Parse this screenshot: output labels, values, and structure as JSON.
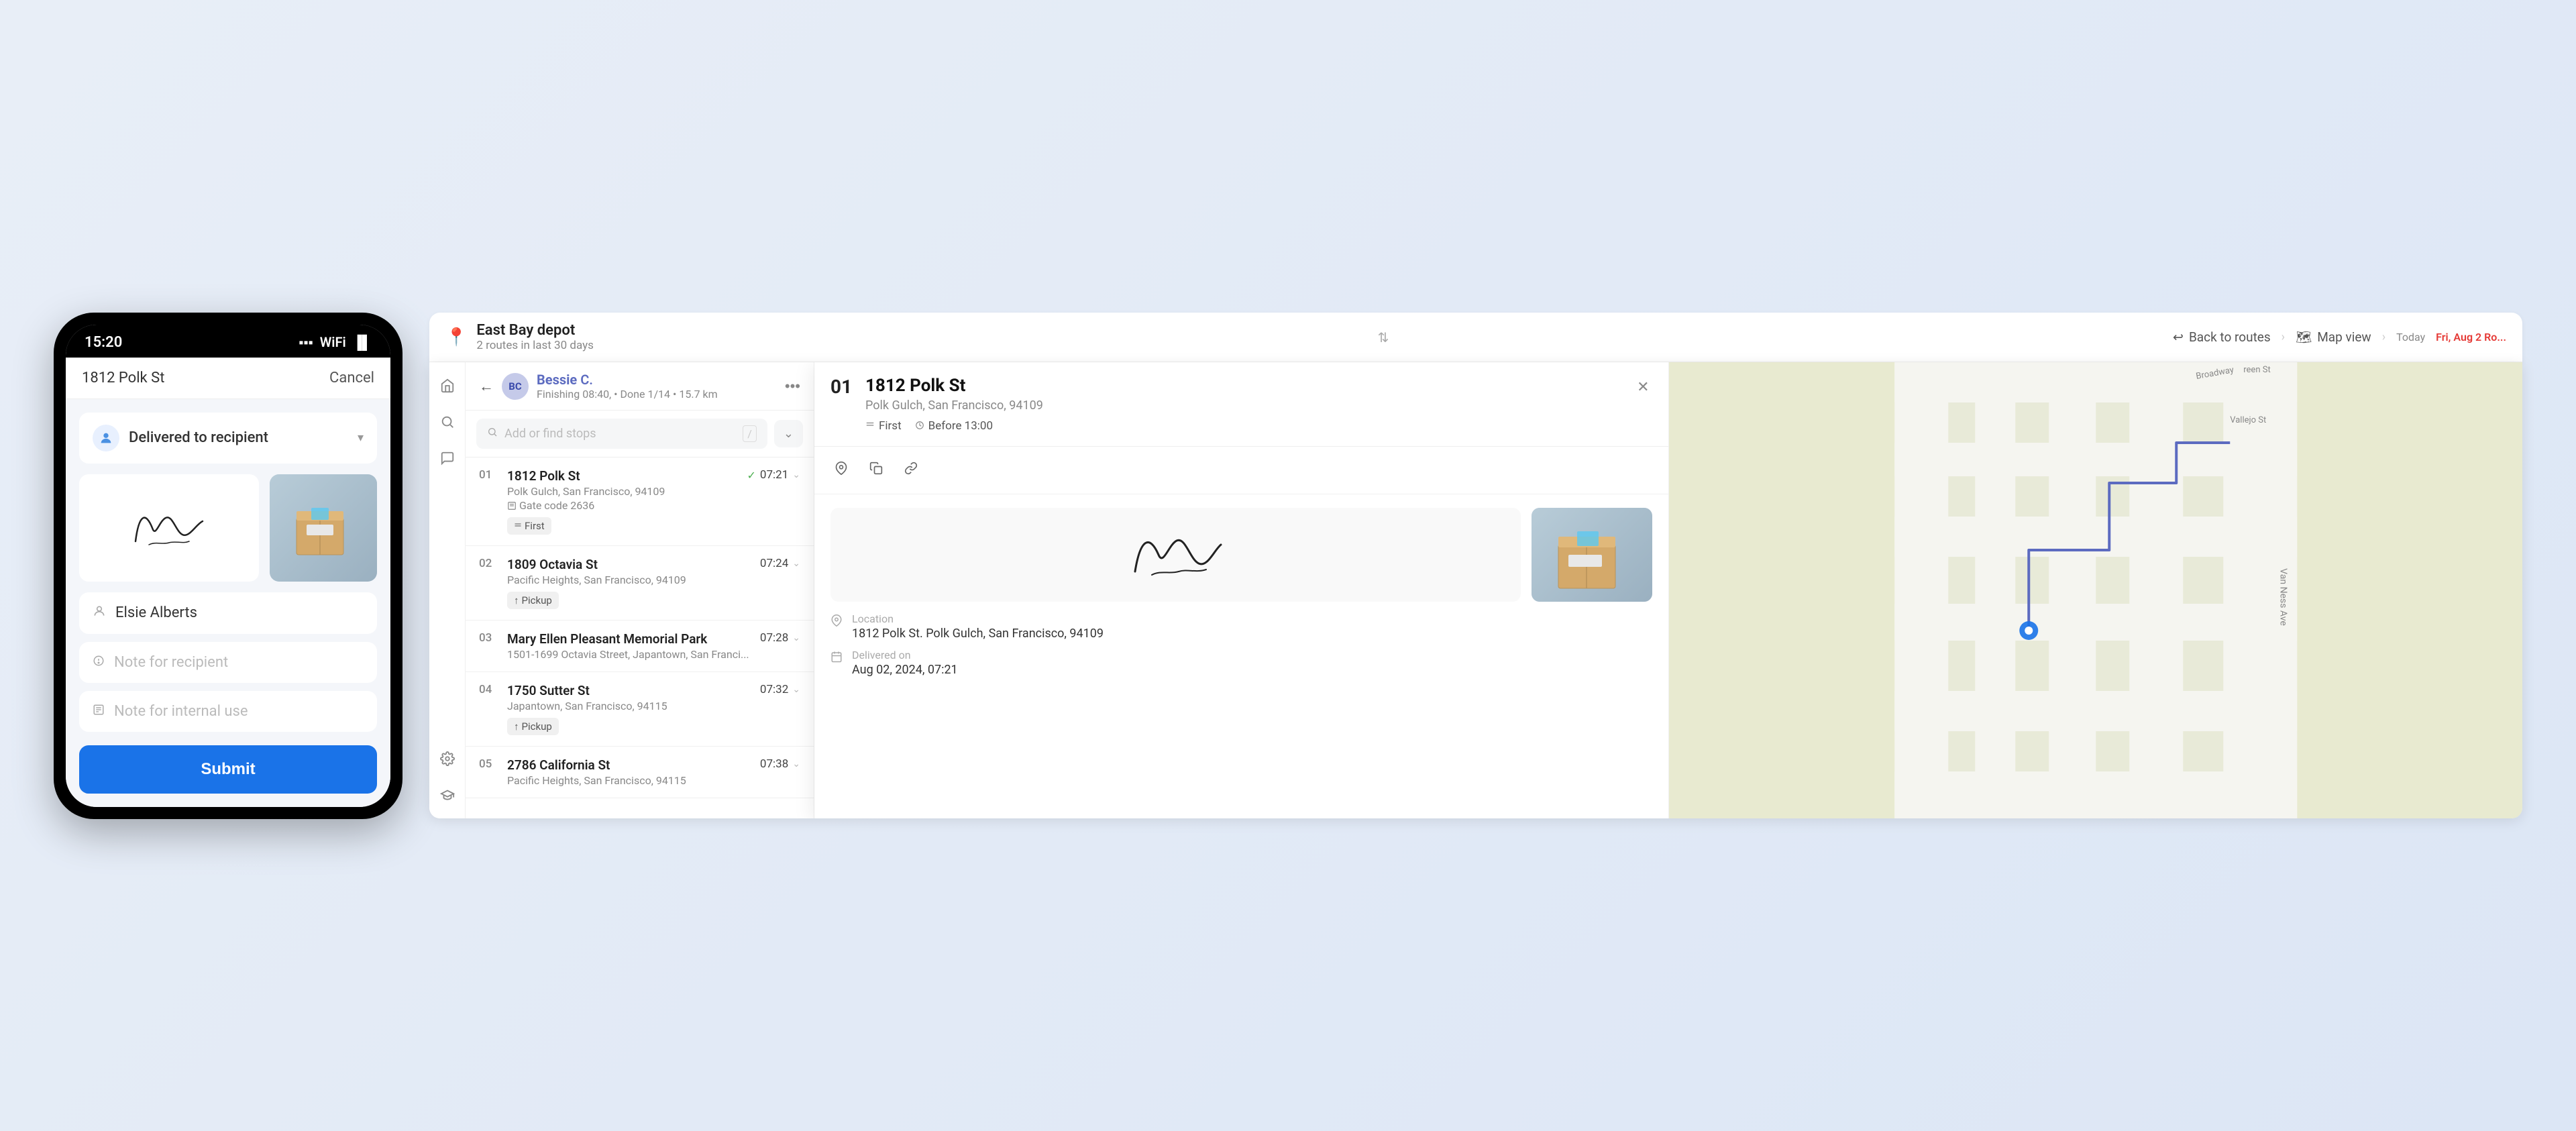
{
  "phone": {
    "status_time": "15:20",
    "address": "1812 Polk St",
    "cancel_label": "Cancel",
    "delivery_status": "Delivered to recipient",
    "recipient_name": "Elsie Alberts",
    "note_recipient_placeholder": "Note for recipient",
    "note_internal_placeholder": "Note for internal use",
    "submit_label": "Submit"
  },
  "top_bar": {
    "back_label": "Back to routes",
    "map_view_label": "Map view",
    "today_label": "Today",
    "date_label": "Fri, Aug 2 Ro..."
  },
  "depot": {
    "name": "East Bay depot",
    "sub": "2 routes in last 30 days"
  },
  "driver": {
    "initials": "BC",
    "name_first": "Bessie",
    "name_last": "C.",
    "status": "Finishing 08:40, • Done 1/14 • 15.7 km"
  },
  "search": {
    "placeholder": "Add or find stops"
  },
  "stops": [
    {
      "num": "01",
      "name": "1812 Polk St",
      "addr": "Polk Gulch, San Francisco, 94109",
      "note": "Gate code 2636",
      "tags": [
        "First"
      ],
      "time": "07:21",
      "done": true
    },
    {
      "num": "02",
      "name": "1809 Octavia St",
      "addr": "Pacific Heights, San Francisco, 94109",
      "note": "",
      "tags": [
        "Pickup"
      ],
      "time": "07:24",
      "done": false
    },
    {
      "num": "03",
      "name": "Mary Ellen Pleasant Memorial Park",
      "addr": "1501-1699 Octavia Street, Japantown, San Franci...",
      "note": "",
      "tags": [],
      "time": "07:28",
      "done": false
    },
    {
      "num": "04",
      "name": "1750 Sutter St",
      "addr": "Japantown, San Francisco, 94115",
      "note": "",
      "tags": [
        "Pickup"
      ],
      "time": "07:32",
      "done": false
    },
    {
      "num": "05",
      "name": "2786 California St",
      "addr": "Pacific Heights, San Francisco, 94115",
      "note": "",
      "tags": [],
      "time": "07:38",
      "done": false
    }
  ],
  "detail": {
    "stop_num": "01",
    "street": "1812 Polk St",
    "city": "Polk Gulch, San Francisco, 94109",
    "tag": "First",
    "before_time": "Before 13:00",
    "location_label": "Location",
    "location_value": "1812 Polk St. Polk Gulch, San Francisco, 94109",
    "delivered_label": "Delivered on",
    "delivered_value": "Aug 02, 2024, 07:21"
  },
  "colors": {
    "blue": "#1a73e8",
    "purple": "#5c6bc0",
    "green": "#4caf50",
    "red": "#e53935",
    "light_purple_bg": "#c5cae9"
  }
}
